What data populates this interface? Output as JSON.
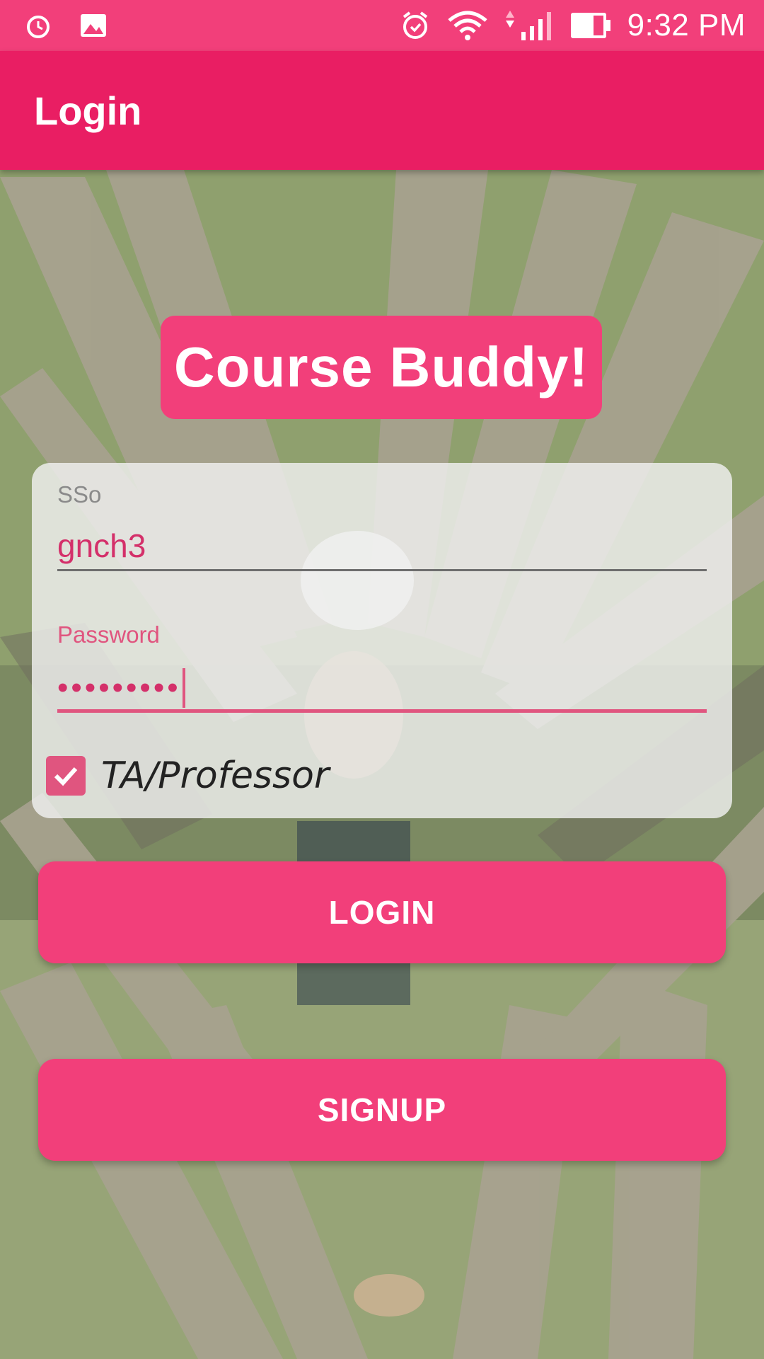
{
  "status_bar": {
    "time": "9:32 PM",
    "icons": [
      "alarm-icon",
      "image-icon",
      "alarm-clock-icon",
      "wifi-icon",
      "signal-icon",
      "battery-icon"
    ]
  },
  "app_bar": {
    "title": "Login"
  },
  "brand": {
    "title": "Course Buddy!"
  },
  "form": {
    "sso_label": "SSo",
    "sso_value": "gnch3",
    "password_label": "Password",
    "password_value": "•••••••••",
    "role_checkbox_label": "TA/Professor",
    "role_checkbox_checked": true
  },
  "buttons": {
    "login": "LOGIN",
    "signup": "SIGNUP"
  },
  "colors": {
    "primary": "#e91e63",
    "accent": "#f23f7a",
    "field_accent": "#e0557f"
  }
}
